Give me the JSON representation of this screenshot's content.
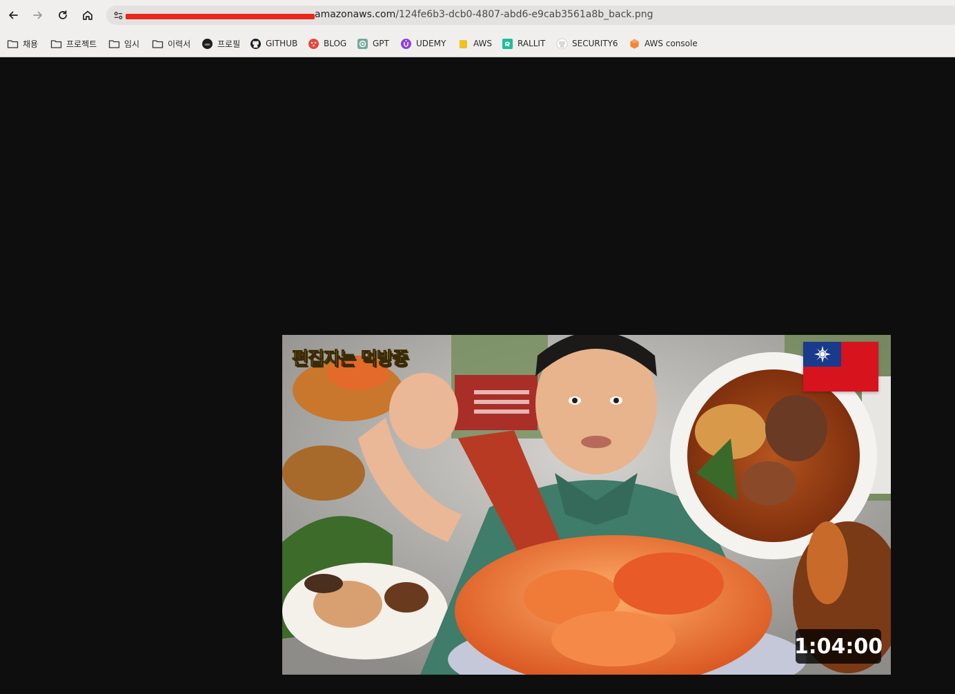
{
  "browser": {
    "url_prefix": "",
    "url_host": "amazonaws.com",
    "url_path": "/124fe6b3-dcb0-4807-abd6-e9cab3561a8b_back.png"
  },
  "bookmarks": [
    {
      "label": "채용",
      "icon": "folder-icon"
    },
    {
      "label": "프로젝트",
      "icon": "folder-icon"
    },
    {
      "label": "임시",
      "icon": "folder-icon"
    },
    {
      "label": "이력서",
      "icon": "folder-icon"
    },
    {
      "label": "프로필",
      "icon": "profile-icon"
    },
    {
      "label": "GITHUB",
      "icon": "github-icon"
    },
    {
      "label": "BLOG",
      "icon": "blog-icon"
    },
    {
      "label": "GPT",
      "icon": "gpt-icon"
    },
    {
      "label": "UDEMY",
      "icon": "udemy-icon"
    },
    {
      "label": "AWS",
      "icon": "aws-icon"
    },
    {
      "label": "RALLIT",
      "icon": "rallit-icon"
    },
    {
      "label": "SECURITY6",
      "icon": "github-icon"
    },
    {
      "label": "AWS console",
      "icon": "aws-console-icon"
    }
  ],
  "thumbnail": {
    "title": "편집자는 먹방중",
    "duration": "1:04:00"
  },
  "colors": {
    "page_background": "#0e0e0e",
    "chrome_background": "#f0efed",
    "redaction": "#e8281d",
    "title_yellow": "#f2c34a",
    "flag_red": "#d7131e",
    "flag_blue": "#1a3a8c"
  }
}
